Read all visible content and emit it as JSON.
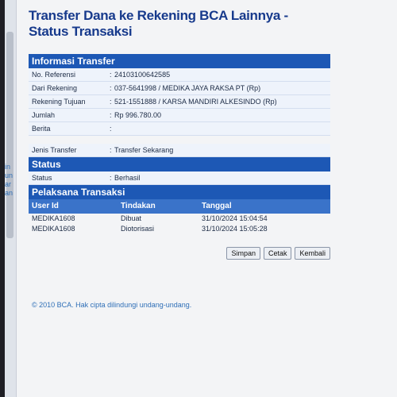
{
  "title": "Transfer Dana ke Rekening BCA Lainnya - Status Transaksi",
  "info": {
    "header": "Informasi Transfer",
    "rows": [
      {
        "label": "No. Referensi",
        "value": "24103100642585"
      },
      {
        "label": "Dari Rekening",
        "value": "037-5641998 / MEDIKA JAYA RAKSA PT (Rp)"
      },
      {
        "label": "Rekening Tujuan",
        "value": "521-1551888 / KARSA MANDIRI ALKESINDO (Rp)"
      },
      {
        "label": "Jumlah",
        "value": "Rp 996.780.00"
      },
      {
        "label": "Berita",
        "value": ""
      }
    ],
    "jenis": {
      "label": "Jenis Transfer",
      "value": "Transfer Sekarang"
    }
  },
  "status": {
    "header": "Status",
    "label": "Status",
    "value": "Berhasil"
  },
  "pelaksana": {
    "header": "Pelaksana Transaksi",
    "columns": [
      "User Id",
      "Tindakan",
      "Tanggal"
    ],
    "rows": [
      {
        "user": "MEDIKA1608",
        "action": "Dibuat",
        "date": "31/10/2024 15:04:54"
      },
      {
        "user": "MEDIKA1608",
        "action": "Diotorisasi",
        "date": "31/10/2024 15:05:28"
      }
    ]
  },
  "buttons": {
    "save": "Simpan",
    "print": "Cetak",
    "back": "Kembali"
  },
  "footer": "© 2010 BCA. Hak cipta dilindungi undang-undang.",
  "sidebar_letters": [
    "in",
    "un",
    "ar",
    "an"
  ]
}
